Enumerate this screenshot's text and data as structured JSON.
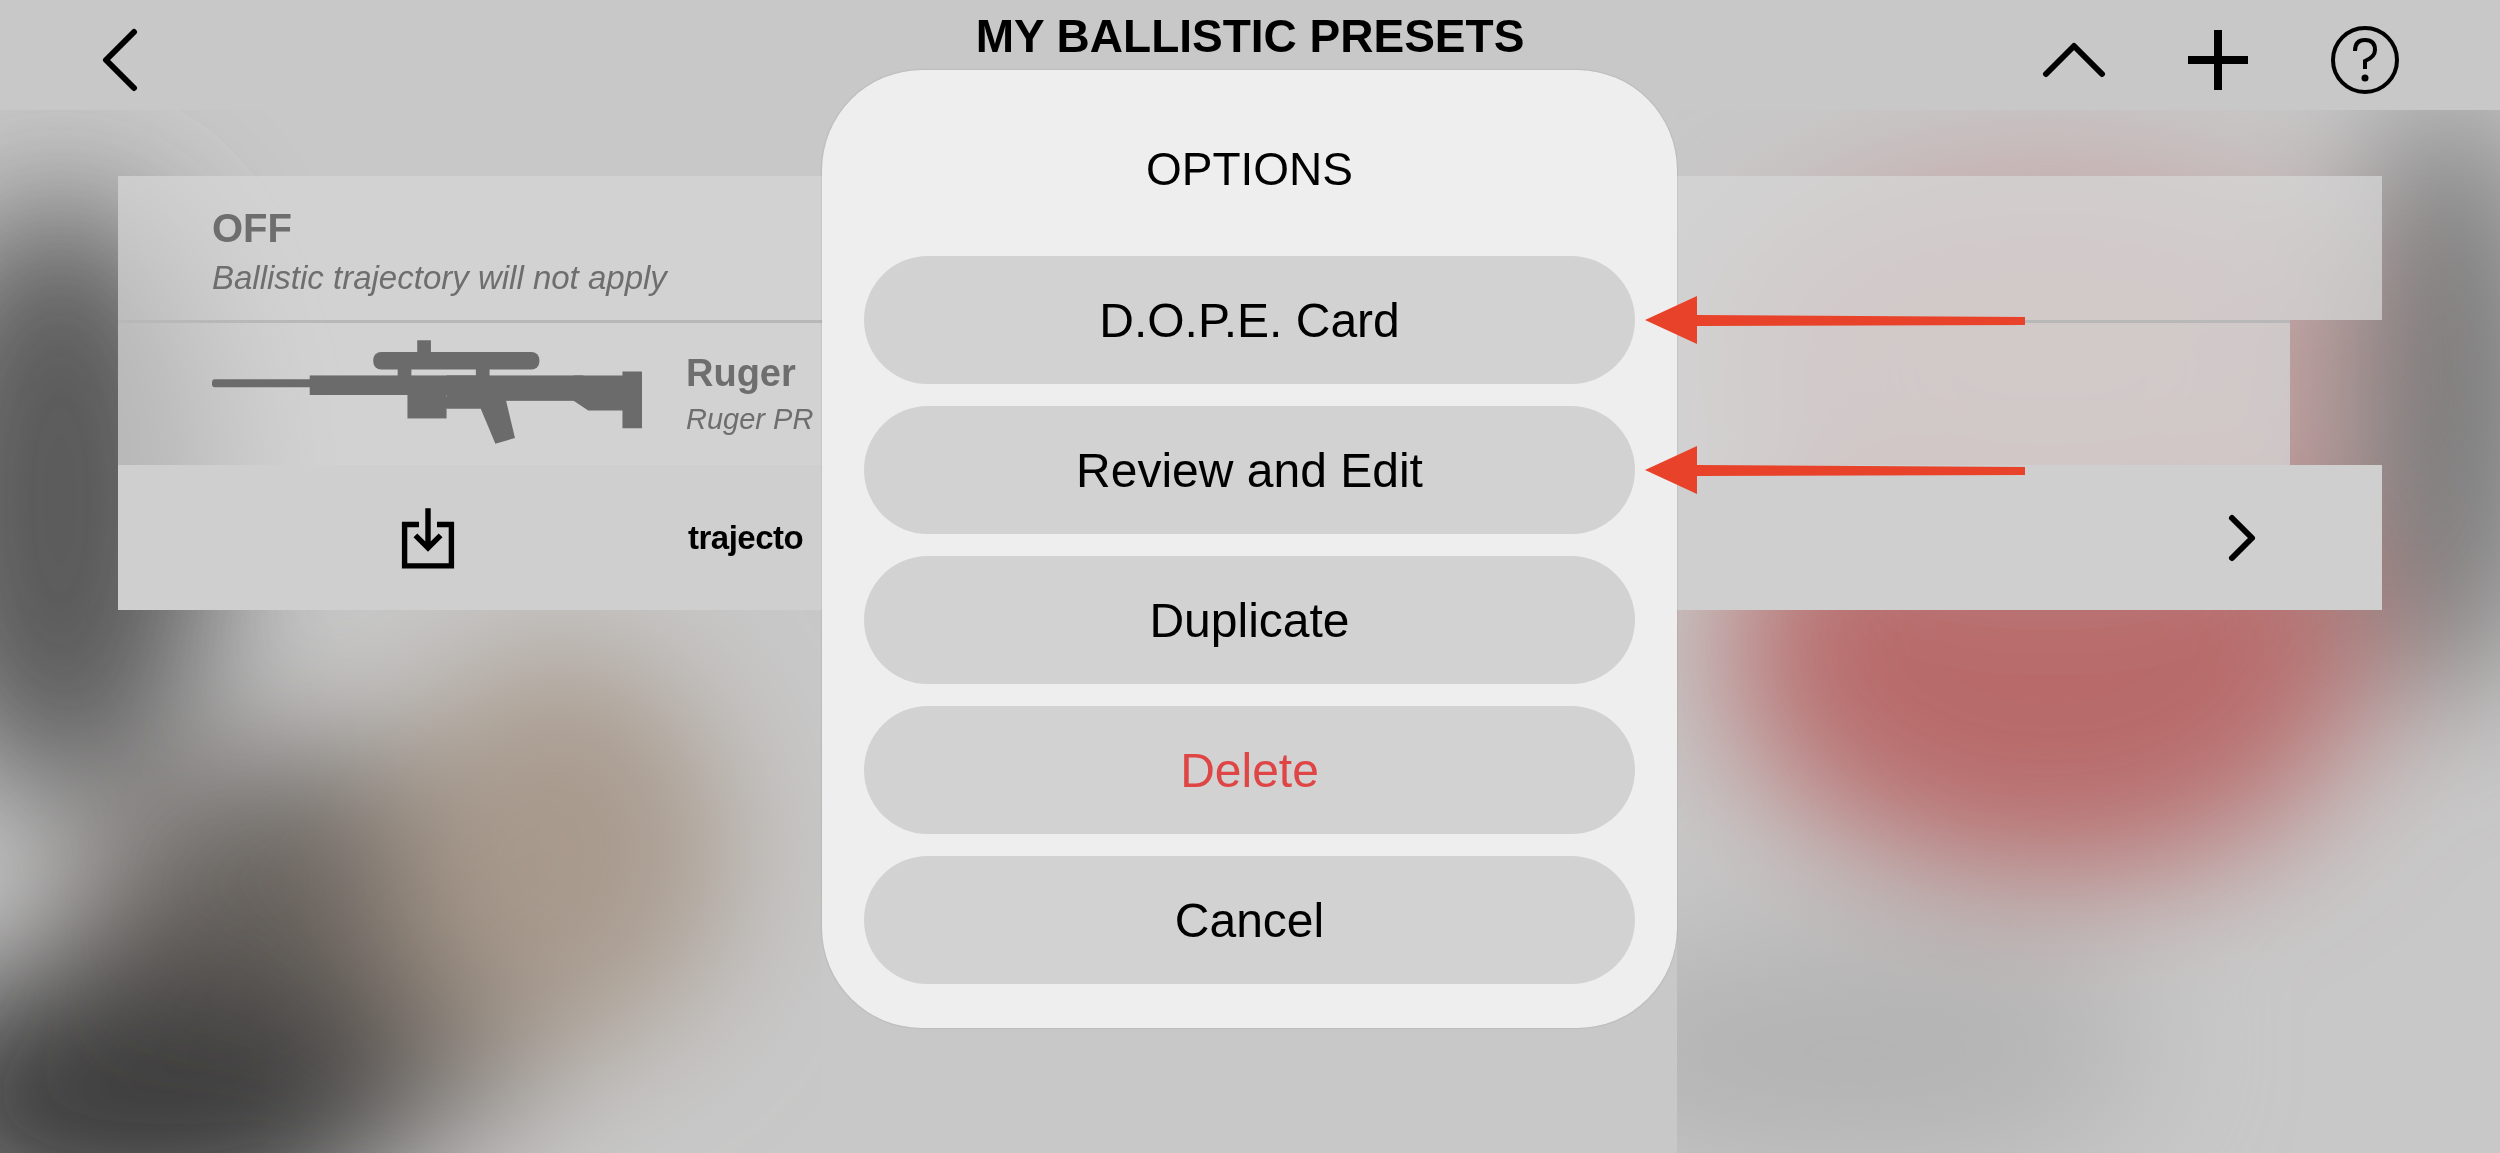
{
  "header": {
    "title": "MY BALLISTIC PRESETS"
  },
  "presets": [
    {
      "kind": "off",
      "title": "OFF",
      "subtitle": "Ballistic trajectory will not apply"
    },
    {
      "kind": "rifle",
      "title": "Ruger",
      "subtitle": "Ruger PR"
    }
  ],
  "footer_row": {
    "label": "trajecto"
  },
  "dialog": {
    "title": "OPTIONS",
    "actions": [
      {
        "label": "D.O.P.E. Card",
        "destructive": false,
        "arrow": true
      },
      {
        "label": "Review and Edit",
        "destructive": false,
        "arrow": true
      },
      {
        "label": "Duplicate",
        "destructive": false,
        "arrow": false
      },
      {
        "label": "Delete",
        "destructive": true,
        "arrow": false
      },
      {
        "label": "Cancel",
        "destructive": false,
        "arrow": false
      }
    ]
  }
}
